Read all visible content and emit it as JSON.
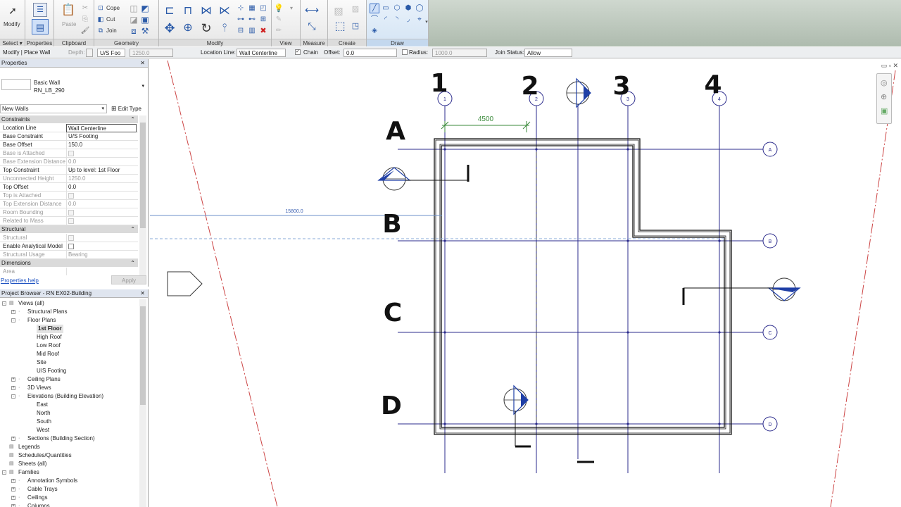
{
  "ribbon": {
    "select": {
      "modify": "Modify",
      "label": "Select ▾"
    },
    "properties": {
      "label": "Properties"
    },
    "clipboard": {
      "paste": "Paste",
      "label": "Clipboard"
    },
    "geometry": {
      "cope": "Cope",
      "cut": "Cut",
      "join": "Join",
      "label": "Geometry"
    },
    "modify": {
      "label": "Modify"
    },
    "view": {
      "label": "View"
    },
    "measure": {
      "label": "Measure"
    },
    "create": {
      "label": "Create"
    },
    "draw": {
      "label": "Draw"
    }
  },
  "options_bar": {
    "mode": "Modify | Place Wall",
    "depth_label": "Depth:",
    "depth_target": "U/S Foo",
    "depth_value": "1250.0",
    "location_label": "Location Line:",
    "location_value": "Wall Centerline",
    "chain_label": "Chain",
    "offset_label": "Offset:",
    "offset_value": "0.0",
    "radius_label": "Radius:",
    "radius_value": "1000.0",
    "join_label": "Join Status:",
    "join_value": "Allow"
  },
  "properties": {
    "title": "Properties",
    "type_family": "Basic Wall",
    "type_name": "RN_LB_290",
    "instance_filter": "New Walls",
    "edit_type": "Edit Type",
    "groups": {
      "constraints": "Constraints",
      "structural": "Structural",
      "dimensions": "Dimensions"
    },
    "constraints": [
      {
        "key": "Location Line",
        "value": "Wall Centerline",
        "grey": false
      },
      {
        "key": "Base Constraint",
        "value": "U/S Footing",
        "grey": false
      },
      {
        "key": "Base Offset",
        "value": "150.0",
        "grey": false
      },
      {
        "key": "Base is Attached",
        "value": "",
        "grey": true
      },
      {
        "key": "Base Extension Distance",
        "value": "0.0",
        "grey": true
      },
      {
        "key": "Top Constraint",
        "value": "Up to level: 1st Floor",
        "grey": false
      },
      {
        "key": "Unconnected Height",
        "value": "1250.0",
        "grey": true
      },
      {
        "key": "Top Offset",
        "value": "0.0",
        "grey": false
      },
      {
        "key": "Top is Attached",
        "value": "",
        "grey": true
      },
      {
        "key": "Top Extension Distance",
        "value": "0.0",
        "grey": true
      },
      {
        "key": "Room Bounding",
        "value": "",
        "grey": true
      },
      {
        "key": "Related to Mass",
        "value": "",
        "grey": true
      }
    ],
    "structural": [
      {
        "key": "Structural",
        "value": "",
        "grey": true
      },
      {
        "key": "Enable Analytical Model",
        "value": "",
        "grey": false
      },
      {
        "key": "Structural Usage",
        "value": "Bearing",
        "grey": true
      }
    ],
    "dimensions": [
      {
        "key": "Area",
        "value": "",
        "grey": true
      }
    ],
    "help": "Properties help",
    "apply": "Apply"
  },
  "browser": {
    "title": "Project Browser - RN EX02-Building",
    "nodes": [
      {
        "label": "Views (all)",
        "indent": 0,
        "toggle": "-",
        "bold": false
      },
      {
        "label": "Structural Plans",
        "indent": 1,
        "toggle": "+",
        "bold": false
      },
      {
        "label": "Floor Plans",
        "indent": 1,
        "toggle": "-",
        "bold": false
      },
      {
        "label": "1st Floor",
        "indent": 2,
        "toggle": "",
        "bold": true
      },
      {
        "label": "High Roof",
        "indent": 2,
        "toggle": "",
        "bold": false
      },
      {
        "label": "Low Roof",
        "indent": 2,
        "toggle": "",
        "bold": false
      },
      {
        "label": "Mid Roof",
        "indent": 2,
        "toggle": "",
        "bold": false
      },
      {
        "label": "Site",
        "indent": 2,
        "toggle": "",
        "bold": false
      },
      {
        "label": "U/S Footing",
        "indent": 2,
        "toggle": "",
        "bold": false
      },
      {
        "label": "Ceiling Plans",
        "indent": 1,
        "toggle": "+",
        "bold": false
      },
      {
        "label": "3D Views",
        "indent": 1,
        "toggle": "+",
        "bold": false
      },
      {
        "label": "Elevations (Building Elevation)",
        "indent": 1,
        "toggle": "-",
        "bold": false
      },
      {
        "label": "East",
        "indent": 2,
        "toggle": "",
        "bold": false
      },
      {
        "label": "North",
        "indent": 2,
        "toggle": "",
        "bold": false
      },
      {
        "label": "South",
        "indent": 2,
        "toggle": "",
        "bold": false
      },
      {
        "label": "West",
        "indent": 2,
        "toggle": "",
        "bold": false
      },
      {
        "label": "Sections (Building Section)",
        "indent": 1,
        "toggle": "+",
        "bold": false
      },
      {
        "label": "Legends",
        "indent": 0,
        "toggle": "",
        "bold": false
      },
      {
        "label": "Schedules/Quantities",
        "indent": 0,
        "toggle": "",
        "bold": false
      },
      {
        "label": "Sheets (all)",
        "indent": 0,
        "toggle": "",
        "bold": false
      },
      {
        "label": "Families",
        "indent": 0,
        "toggle": "-",
        "bold": false
      },
      {
        "label": "Annotation Symbols",
        "indent": 1,
        "toggle": "+",
        "bold": false
      },
      {
        "label": "Cable Trays",
        "indent": 1,
        "toggle": "+",
        "bold": false
      },
      {
        "label": "Ceilings",
        "indent": 1,
        "toggle": "+",
        "bold": false
      },
      {
        "label": "Columns",
        "indent": 1,
        "toggle": "+",
        "bold": false
      }
    ]
  },
  "drawing": {
    "grid_numbers": [
      "1",
      "2",
      "3",
      "4"
    ],
    "grid_letters": [
      "A",
      "B",
      "C",
      "D"
    ],
    "bubble_numbers": [
      "1",
      "2",
      "3",
      "4"
    ],
    "bubble_letters": [
      "A",
      "B",
      "C",
      "D"
    ],
    "dim_4500": "4500",
    "dim_15800": "15800.0",
    "line_color": "#2b2b8c",
    "dim_color": "#3a8a3a",
    "elev_color": "#1f3fa6"
  }
}
